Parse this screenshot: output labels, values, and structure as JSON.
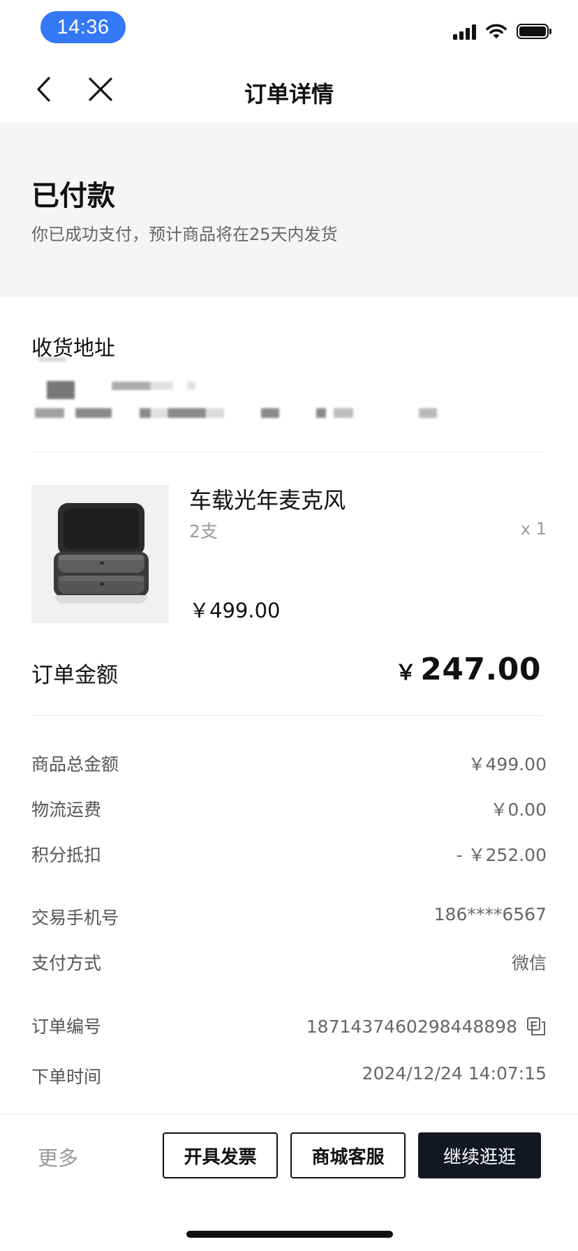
{
  "status_bar": {
    "time": "14:36"
  },
  "nav": {
    "title": "订单详情"
  },
  "order_status": {
    "title": "已付款",
    "description": "你已成功支付，预计商品将在25天内发货"
  },
  "address": {
    "label": "收货地址"
  },
  "product": {
    "name": "车载光年麦克风",
    "spec": "2支",
    "quantity": "x 1",
    "price": "￥499.00"
  },
  "order_total": {
    "label": "订单金额",
    "currency": "￥",
    "amount": "247.00"
  },
  "details": [
    {
      "label": "商品总金额",
      "value": "￥499.00"
    },
    {
      "label": "物流运费",
      "value": "￥0.00"
    },
    {
      "label": "积分抵扣",
      "value": "- ￥252.00"
    },
    {
      "label": "交易手机号",
      "value": "186****6567"
    },
    {
      "label": "支付方式",
      "value": "微信"
    },
    {
      "label": "订单编号",
      "value": "1871437460298448898"
    },
    {
      "label": "下单时间",
      "value": "2024/12/24 14:07:15"
    }
  ],
  "bottom_bar": {
    "more": "更多",
    "invoice_button": "开具发票",
    "service_button": "商城客服",
    "continue_button": "继续逛逛"
  },
  "colors": {
    "time_pill": "#3478f6",
    "primary_dark": "#141621",
    "status_background": "#f5f5f5",
    "muted_text": "#999999"
  },
  "icons": {
    "back": "chevron-left-icon",
    "close": "close-icon",
    "copy": "copy-icon",
    "signal": "cellular-signal-icon",
    "wifi": "wifi-icon",
    "battery": "battery-icon"
  }
}
